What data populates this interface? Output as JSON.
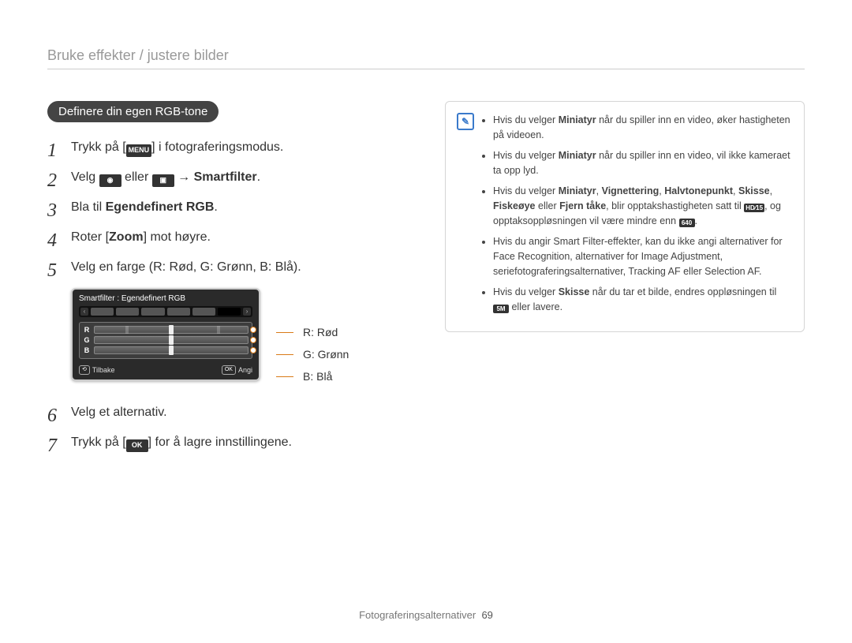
{
  "breadcrumb": "Bruke effekter / justere bilder",
  "section_pill": "Definere din egen RGB-tone",
  "icons": {
    "menu": "MENU",
    "camera": "◉",
    "video": "▣",
    "ok": "OK",
    "hd15": "HD⁄15",
    "res640": "640",
    "res5m": "5M"
  },
  "steps": [
    {
      "n": "1",
      "pre": "Trykk på [",
      "icon": "menu",
      "post": "] i fotograferingsmodus."
    },
    {
      "n": "2",
      "pre": "Velg ",
      "icon": "camera",
      "mid": " eller ",
      "icon2": "video",
      "arrow": " → ",
      "bold": "Smartfilter",
      "after": "."
    },
    {
      "n": "3",
      "pre": "Bla til ",
      "bold": "Egendefinert RGB",
      "after": "."
    },
    {
      "n": "4",
      "pre": "Roter [",
      "bold": "Zoom",
      "after": "] mot høyre."
    },
    {
      "n": "5",
      "pre": "Velg en farge (R: Rød, G: Grønn, B: Blå)."
    }
  ],
  "lcd": {
    "title": "Smartfilter : Egendefinert RGB",
    "rows": [
      {
        "letter": "R"
      },
      {
        "letter": "G"
      },
      {
        "letter": "B"
      }
    ],
    "back_label": "Tilbake",
    "set_chip": "OK",
    "set_label": "Angi"
  },
  "rgb_caption": {
    "r": "R: Rød",
    "g": "G: Grønn",
    "b": "B: Blå"
  },
  "steps_after": [
    {
      "n": "6",
      "text": "Velg et alternativ."
    },
    {
      "n": "7",
      "pre": "Trykk på [",
      "icon": "ok",
      "post": "] for å lagre innstillingene."
    }
  ],
  "note": {
    "items": [
      {
        "t1": "Hvis du velger ",
        "b1": "Miniatyr",
        "t2": " når du spiller inn en video, øker hastigheten på videoen."
      },
      {
        "t1": "Hvis du velger ",
        "b1": "Miniatyr",
        "t2": " når du spiller inn en video, vil ikke kameraet ta opp lyd."
      },
      {
        "t1": "Hvis du velger ",
        "b1": "Miniatyr",
        "t2": ", ",
        "b2": "Vignettering",
        "t3": ", ",
        "b3": "Halvtonepunkt",
        "t4": ", ",
        "b4": "Skisse",
        "t5": ", ",
        "b5": "Fiskeøye",
        "t6": " eller ",
        "b6": "Fjern tåke",
        "t7": ", blir opptakshastigheten satt til ",
        "icon1": "hd15",
        "t8": ", og opptaksoppløsningen vil være mindre enn ",
        "icon2": "res640",
        "t9": "."
      },
      {
        "t1": "Hvis du angir Smart Filter-effekter, kan du ikke angi alternativer for Face Recognition, alternativer for Image Adjustment, seriefotograferingsalternativer, Tracking AF eller Selection AF."
      },
      {
        "t1": "Hvis du velger ",
        "b1": "Skisse",
        "t2": " når du tar et bilde, endres oppløsningen til ",
        "icon1": "res5m",
        "t3": " eller lavere."
      }
    ]
  },
  "footer": {
    "section": "Fotograferingsalternativer",
    "page": "69"
  }
}
